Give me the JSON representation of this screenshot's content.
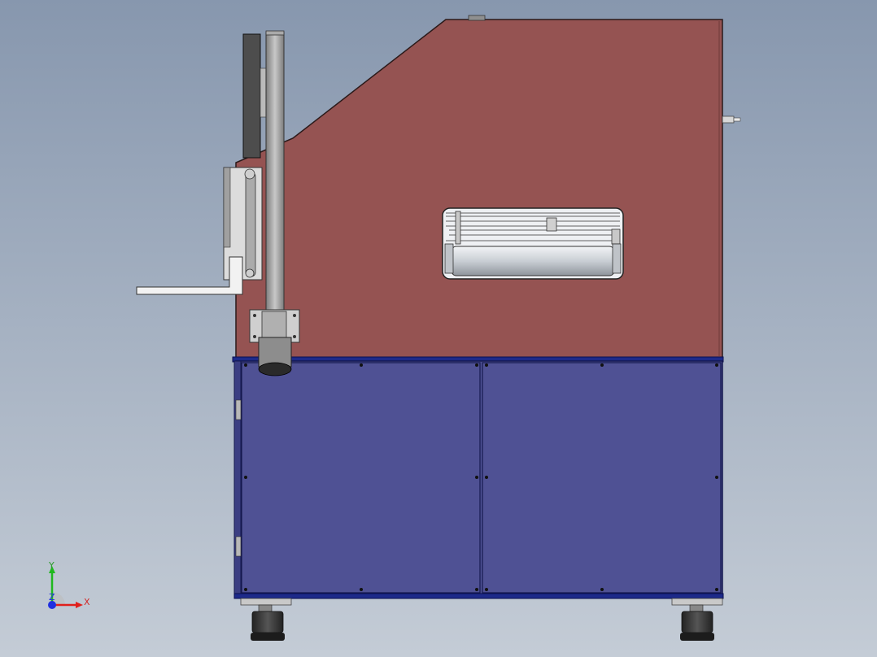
{
  "view": {
    "background_top": "#8797ae",
    "background_bottom": "#c4ccd6"
  },
  "model": {
    "upper_housing_color": "#955352",
    "lower_cabinet_color": "#4f5194",
    "cabinet_trim_color": "#1d2a8a",
    "metal_color": "#9a9a9a"
  },
  "triad": {
    "x_label": "X",
    "y_label": "Y",
    "z_label": "Z",
    "x_color": "#e0201c",
    "y_color": "#1fb81f",
    "z_color": "#1f2fe0"
  }
}
